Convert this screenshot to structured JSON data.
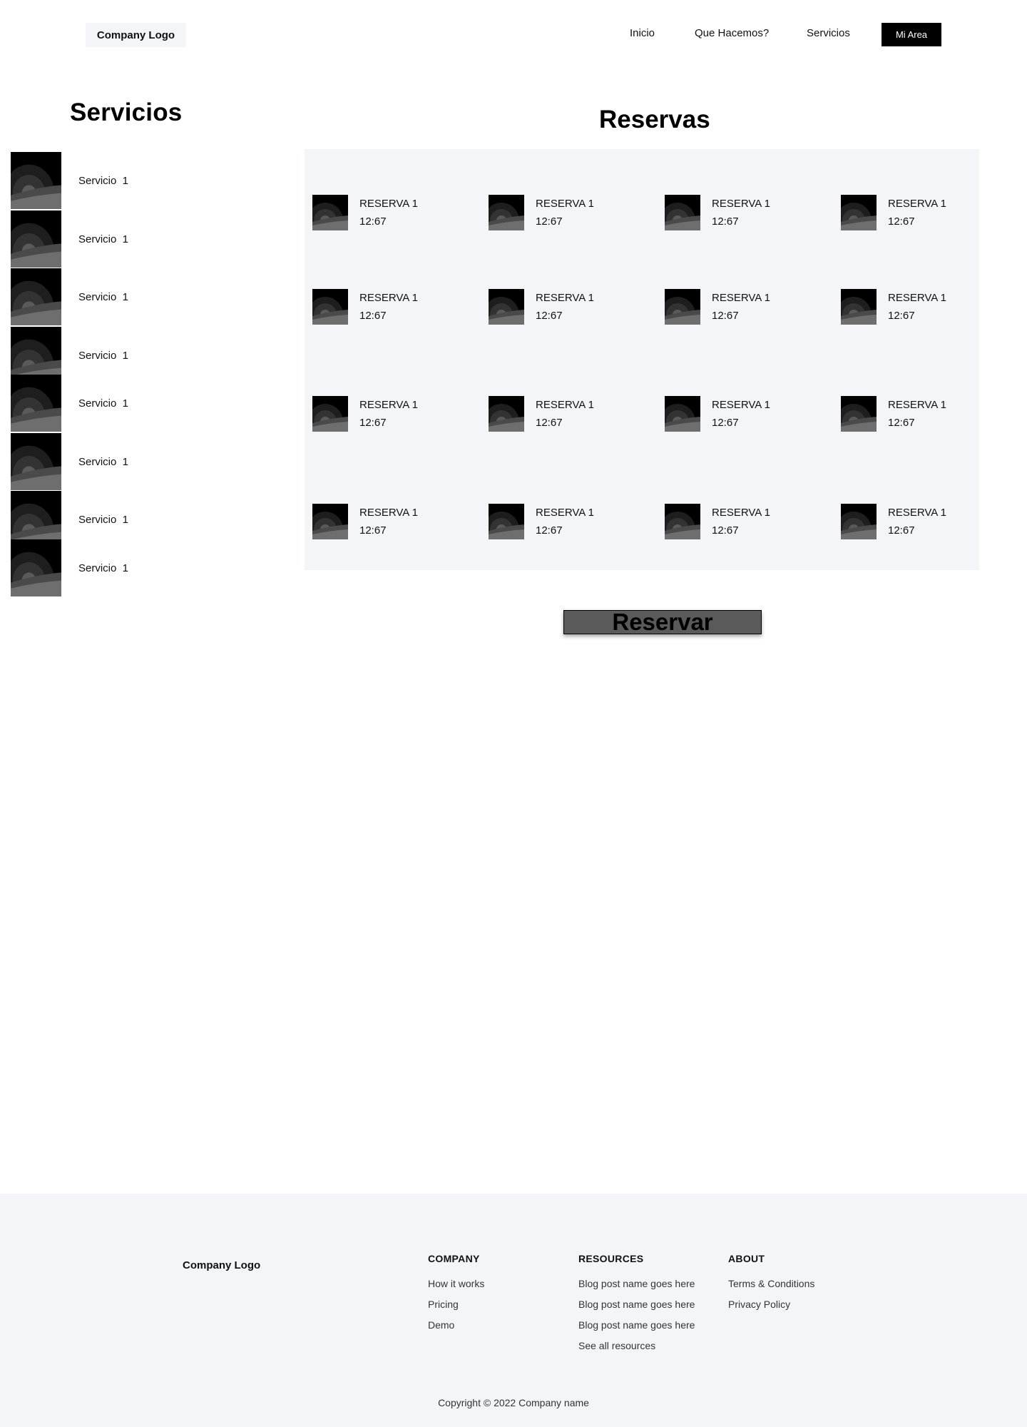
{
  "header": {
    "logo": "Company Logo",
    "nav": [
      "Inicio",
      "Que Hacemos?",
      "Servicios"
    ],
    "cta": "Mi Area"
  },
  "servicios": {
    "title": "Servicios",
    "items": [
      "Servicio  1",
      "Servicio  1",
      "Servicio  1",
      "Servicio  1",
      "Servicio  1",
      "Servicio  1",
      "Servicio  1",
      "Servicio  1"
    ]
  },
  "reservas": {
    "title": "Reservas",
    "rows": [
      [
        {
          "name": "RESERVA 1",
          "time": "12:67"
        },
        {
          "name": "RESERVA 1",
          "time": "12:67"
        },
        {
          "name": "RESERVA 1",
          "time": "12:67"
        },
        {
          "name": "RESERVA 1",
          "time": "12:67"
        }
      ],
      [
        {
          "name": "RESERVA 1",
          "time": "12:67"
        },
        {
          "name": "RESERVA 1",
          "time": "12:67"
        },
        {
          "name": "RESERVA 1",
          "time": "12:67"
        },
        {
          "name": "RESERVA 1",
          "time": "12:67"
        }
      ],
      [
        {
          "name": "RESERVA 1",
          "time": "12:67"
        },
        {
          "name": "RESERVA 1",
          "time": "12:67"
        },
        {
          "name": "RESERVA 1",
          "time": "12:67"
        },
        {
          "name": "RESERVA 1",
          "time": "12:67"
        }
      ],
      [
        {
          "name": "RESERVA 1",
          "time": "12:67"
        },
        {
          "name": "RESERVA 1",
          "time": "12:67"
        },
        {
          "name": "RESERVA 1",
          "time": "12:67"
        },
        {
          "name": "RESERVA 1",
          "time": "12:67"
        }
      ]
    ],
    "button": "Reservar"
  },
  "footer": {
    "logo": "Company Logo",
    "company": {
      "heading": "COMPANY",
      "links": [
        "How it works",
        "Pricing",
        "Demo"
      ]
    },
    "resources": {
      "heading": "RESOURCES",
      "links": [
        "Blog post name goes here",
        "Blog post name goes here",
        "Blog post name goes here",
        "See all resources"
      ]
    },
    "about": {
      "heading": "ABOUT",
      "links": [
        "Terms & Conditions",
        "Privacy Policy"
      ]
    },
    "copyright": "Copyright © 2022 Company name"
  },
  "colors": {
    "panel_bg": "#f4f5f8",
    "cta_bg": "#000000",
    "reservar_bg": "#5a5a5a"
  },
  "icons": {
    "image_placeholder": "image-placeholder-icon"
  }
}
